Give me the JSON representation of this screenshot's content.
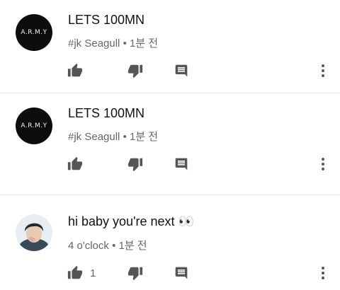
{
  "comments": [
    {
      "avatar_text": "A.R.M.Y",
      "text": "LETS 100MN",
      "author": "#jk Seagull",
      "separator": "•",
      "time": "1분 전",
      "likes": ""
    },
    {
      "avatar_text": "A.R.M.Y",
      "text": "LETS 100MN",
      "author": "#jk Seagull",
      "separator": "•",
      "time": "1분 전",
      "likes": ""
    },
    {
      "avatar_text": "",
      "text": "hi baby you're next 👀",
      "author": "4 o'clock",
      "separator": "•",
      "time": "1분 전",
      "likes": "1"
    }
  ],
  "icons": {
    "like": "thumbs-up-icon",
    "dislike": "thumbs-down-icon",
    "reply": "reply-icon",
    "more": "more-vertical-icon"
  },
  "colors": {
    "icon": "#555555",
    "meta": "#666666",
    "avatar_dark": "#0d0d0d"
  }
}
